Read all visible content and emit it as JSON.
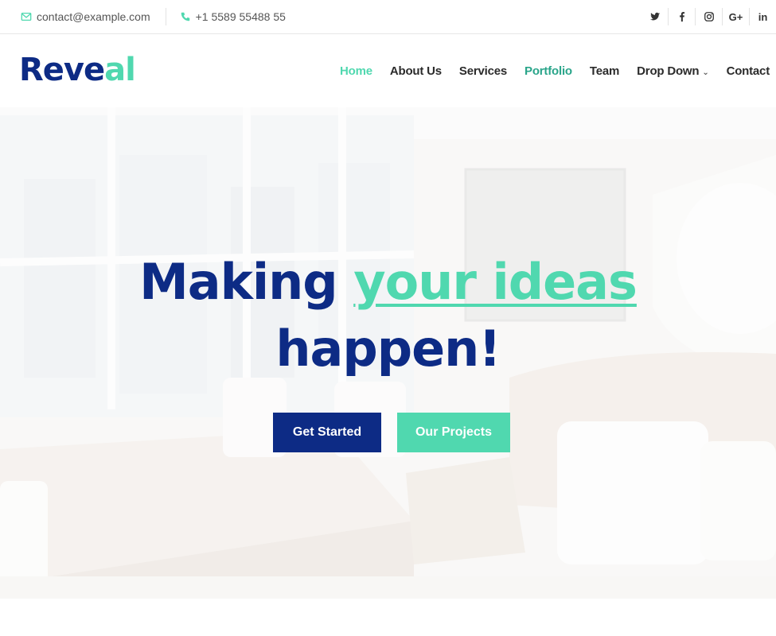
{
  "topbar": {
    "email": "contact@example.com",
    "phone": "+1 5589 55488 55",
    "social": [
      {
        "icon": "twitter-icon"
      },
      {
        "icon": "facebook-icon"
      },
      {
        "icon": "instagram-icon"
      },
      {
        "icon": "google-plus-icon",
        "label": "G+"
      },
      {
        "icon": "linkedin-icon",
        "label": "in"
      }
    ]
  },
  "logo": {
    "part1": "Reve",
    "part2": "al"
  },
  "nav": {
    "home": "Home",
    "about": "About Us",
    "services": "Services",
    "portfolio": "Portfolio",
    "team": "Team",
    "dropdown": "Drop Down",
    "contact": "Contact"
  },
  "hero": {
    "line1_a": "Making ",
    "line1_b": "your ideas",
    "line2": "happen!",
    "btn_primary": "Get Started",
    "btn_secondary": "Our Projects"
  },
  "colors": {
    "brand": "#0d2b85",
    "accent": "#50d8af"
  }
}
